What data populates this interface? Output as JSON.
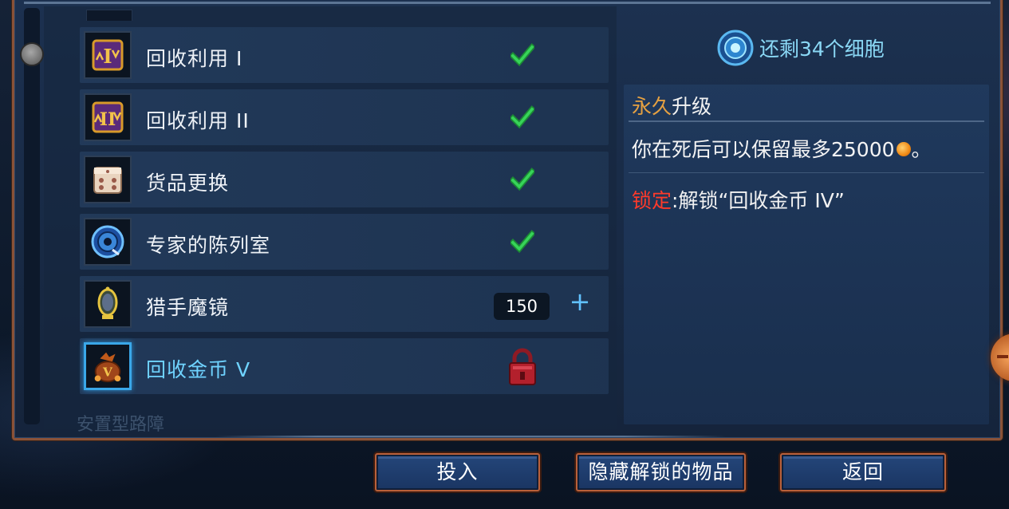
{
  "colors": {
    "accent_blue": "#3aa7e8",
    "check_green": "#2fd04a",
    "title_gold": "#e4a042",
    "lock_red": "#ff3a2a",
    "frame_copper": "#b9603a"
  },
  "list": {
    "items": [
      {
        "name": "回收利用 I",
        "icon": "recycle-gold-1-icon",
        "status": "unlocked"
      },
      {
        "name": "回收利用 II",
        "icon": "recycle-gold-2-icon",
        "status": "unlocked"
      },
      {
        "name": "货品更换",
        "icon": "dice-icon",
        "status": "unlocked"
      },
      {
        "name": "专家的陈列室",
        "icon": "blue-disc-icon",
        "status": "unlocked"
      },
      {
        "name": "猎手魔镜",
        "icon": "mirror-icon",
        "status": "purchasable",
        "cost": "150"
      },
      {
        "name": "回收金币 V",
        "icon": "coin-bag-icon",
        "status": "locked"
      }
    ],
    "faded_next_label": "安置型路障"
  },
  "info": {
    "cells_remaining": "还剩34个细胞",
    "title_highlight": "永久",
    "title_rest": "升级",
    "description": "你在死后可以保留最多25000",
    "description_suffix": "。",
    "lock_label": "锁定",
    "lock_text": ":解锁“回收金币 IV”"
  },
  "buttons": {
    "invest": "投入",
    "hide_unlocked": "隐藏解锁的物品",
    "back": "返回"
  }
}
